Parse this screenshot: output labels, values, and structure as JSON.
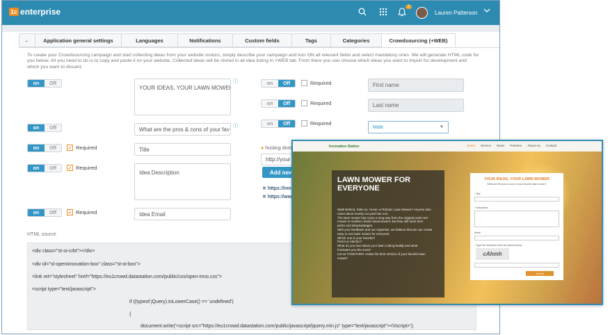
{
  "app": {
    "logo_badge": "1c",
    "logo_text": "enterprise",
    "notif_count": "2",
    "user_name": "Lauren Patterson"
  },
  "tabs": {
    "back_icon": "←",
    "items": [
      "Application general settings",
      "Languages",
      "Notifications",
      "Custom fields",
      "Tags",
      "Categories",
      "Crowdsourcing (+WEB)"
    ]
  },
  "description": "To create your Crowdsourcing campaign and start collecting ideas from your website visitors, simply describe your campaign and turn ON all relevant fields and select mandatory ones. We will generate HTML code for you below. All you need to do is to copy and paste it on your website. Collected ideas will be stored in all idea listing in +WEB tab. From there you can choose which ideas you want to import for development and which you want to discard.",
  "toggle": {
    "on": "on",
    "off": "Off"
  },
  "required_label": "Required",
  "left_fields": {
    "title_value": "YOUR IDEAS, YOUR LAWN MOWER",
    "subtitle_value": "What are the pros & cons of your fav",
    "title_ph": "Title",
    "desc_ph": "Idea Description",
    "email_ph": "Idea Email"
  },
  "right_fields": {
    "first_name": "First name",
    "last_name": "Last name",
    "gender": "Male"
  },
  "hosting": {
    "label": "hosting dom",
    "url_value": "http://your",
    "add_button": "Add new",
    "urls": [
      "https://inno",
      "https://ww"
    ]
  },
  "html_source": {
    "label": "HTML source",
    "lines": [
      "<div class=\"st-oi-crbt\"></div>",
      "<div id=\"sl-openinnovation-box\" class=\"st-oi-box\">",
      "<link rel=\"stylesheet\" href=\"https://eu1crowd.datastation.com/public/css/open-inno.css\">",
      "<script type=\"text/javascript\">",
      "if ((typeof jQuery).toLowerCase() == 'undefined')",
      "{",
      "document.write('<script src=\"https://eu1crowd.datastation.com/public/javascript/jquery.min.js\" type=\"text/javascript\"><\\/script>');"
    ]
  },
  "preview": {
    "nav": [
      "Home",
      "Service",
      "News",
      "Partners",
      "About Us",
      "Contact"
    ],
    "logo": "Innovation Station",
    "title": "LAWN MOWER FOR EVERYONE",
    "body_lines": [
      "Walk Behind, Ride-on, Hover or Robotic Lawn Mower? Anyone who",
      "cares about evenly cut yard has one.",
      "The lawn mower has come a long way from the original push reel",
      "mower to modern robotic lawnmowers, but they still have their",
      "perks and disadvantages.",
      "With your feedback and our expertise, we believe that we can create",
      "easy to use lawn mower for everyone.",
      "Which one is your favorite?",
      "Petrol or electric?",
      "What do you love about your lawn cutting buddy and what",
      "frustrates you the most?",
      "Let us TOGETHER create the best version of your favorite lawn",
      "mower!"
    ],
    "form_title": "YOUR IDEAS, YOUR LAWN MOWER",
    "form_sub": "What are the pros & cons of your favorite lawn mower?",
    "form_labels": [
      "* Title",
      "* Description",
      "Email",
      "* Type the characters from the picture below"
    ],
    "captcha": "cAhmh",
    "submit": "Submit"
  }
}
